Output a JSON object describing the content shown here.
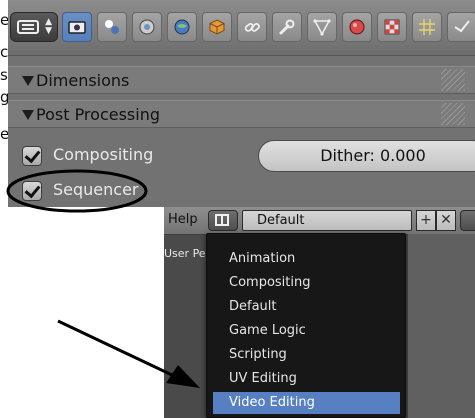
{
  "side_text": [
    "e",
    "c",
    "s",
    "g",
    "e"
  ],
  "properties_editor": {
    "context_tabs": [
      {
        "name": "render",
        "active": true
      },
      {
        "name": "render-layers",
        "active": false
      },
      {
        "name": "scene",
        "active": false
      },
      {
        "name": "world",
        "active": false
      },
      {
        "name": "object",
        "active": false
      },
      {
        "name": "constraints",
        "active": false
      },
      {
        "name": "modifiers",
        "active": false
      },
      {
        "name": "data",
        "active": false
      },
      {
        "name": "material",
        "active": false
      },
      {
        "name": "texture",
        "active": false
      },
      {
        "name": "particles",
        "active": false
      },
      {
        "name": "physics",
        "active": false
      }
    ],
    "panels": {
      "dimensions": "Dimensions",
      "post_processing": "Post Processing"
    },
    "compositing_label": "Compositing",
    "sequencer_label": "Sequencer",
    "dither_label": "Dither: 0.000",
    "colors": {
      "active_tab": "#5680bd",
      "annotation": "#000000"
    }
  },
  "info_header": {
    "menu_help": "Help",
    "screen_layout_value": "Default",
    "add_button": "+",
    "remove_button": "✕"
  },
  "viewport_label": "User Persp",
  "layout_menu": {
    "items": [
      "Animation",
      "Compositing",
      "Default",
      "Game Logic",
      "Scripting",
      "UV Editing",
      "Video Editing"
    ],
    "selected": "Video Editing",
    "selection_color": "#5680c2"
  }
}
